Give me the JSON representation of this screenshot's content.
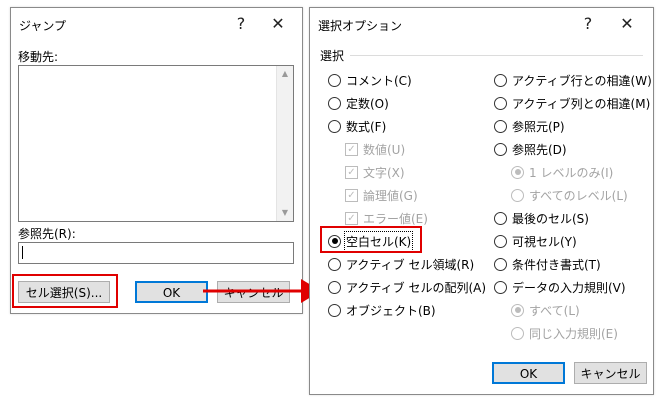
{
  "jump_dialog": {
    "title": "ジャンプ",
    "help": "?",
    "close": "✕",
    "goto_label": "移動先:",
    "reference_label": "参照先(R):",
    "reference_value": "",
    "special_button": "セル選択(S)...",
    "ok": "OK",
    "cancel": "キャンセル"
  },
  "options_dialog": {
    "title": "選択オプション",
    "help": "?",
    "close": "✕",
    "group_title": "選択",
    "left_options": [
      "コメント(C)",
      "定数(O)",
      "数式(F)",
      "空白セル(K)",
      "アクティブ セル領域(R)",
      "アクティブ セルの配列(A)",
      "オブジェクト(B)"
    ],
    "formula_subs": [
      "数値(U)",
      "文字(X)",
      "論理値(G)",
      "エラー値(E)"
    ],
    "right_options": [
      "アクティブ行との相違(W)",
      "アクティブ列との相違(M)",
      "参照元(P)",
      "参照先(D)",
      "最後のセル(S)",
      "可視セル(Y)",
      "条件付き書式(T)",
      "データの入力規則(V)"
    ],
    "dependents_subs": [
      "1 レベルのみ(I)",
      "すべてのレベル(L)"
    ],
    "validation_subs": [
      "すべて(L)",
      "同じ入力規則(E)"
    ],
    "selected_option": "空白セル(K)",
    "ok": "OK",
    "cancel": "キャンセル"
  },
  "colors": {
    "highlight": "#e00000",
    "default_button_border": "#0078d7"
  }
}
